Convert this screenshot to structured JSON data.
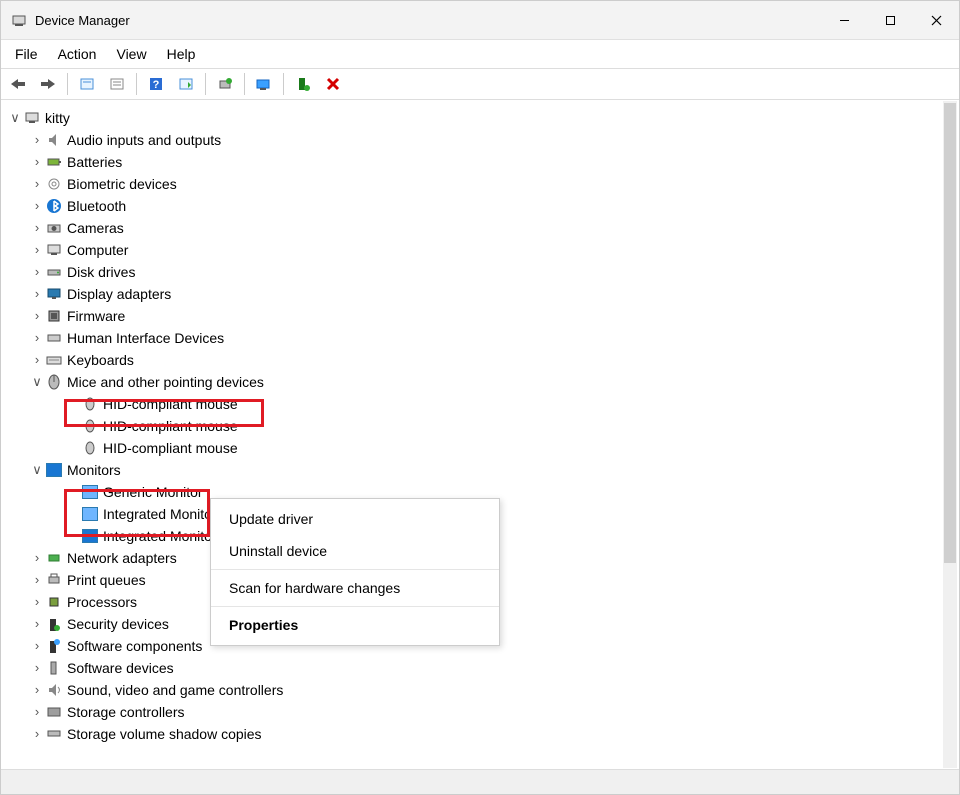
{
  "window": {
    "title": "Device Manager"
  },
  "menu": {
    "file": "File",
    "action": "Action",
    "view": "View",
    "help": "Help"
  },
  "tree": {
    "root": "kitty",
    "items": [
      "Audio inputs and outputs",
      "Batteries",
      "Biometric devices",
      "Bluetooth",
      "Cameras",
      "Computer",
      "Disk drives",
      "Display adapters",
      "Firmware",
      "Human Interface Devices",
      "Keyboards"
    ],
    "mice": {
      "label": "Mice and other pointing devices",
      "children": [
        "HID-compliant mouse",
        "HID-compliant mouse",
        "HID-compliant mouse"
      ]
    },
    "monitors": {
      "label": "Monitors",
      "children": [
        "Generic Monitor",
        "Integrated Monitor",
        "Integrated Monitor"
      ]
    },
    "rest": [
      "Network adapters",
      "Print queues",
      "Processors",
      "Security devices",
      "Software components",
      "Software devices",
      "Sound, video and game controllers",
      "Storage controllers",
      "Storage volume shadow copies"
    ]
  },
  "context": {
    "update": "Update driver",
    "uninstall": "Uninstall device",
    "scan": "Scan for hardware changes",
    "properties": "Properties"
  },
  "toolbar_icons": [
    "back",
    "forward",
    "",
    "show-hidden",
    "properties",
    "help",
    "update-driver",
    "",
    "uninstall",
    "",
    "scan-hardware",
    "",
    "add-legacy",
    "remove"
  ]
}
